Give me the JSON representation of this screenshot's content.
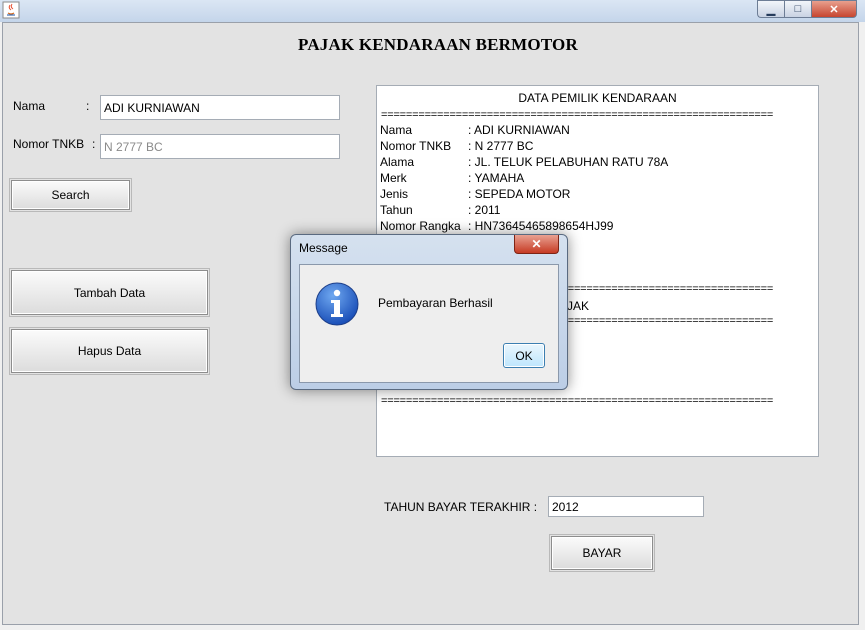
{
  "window": {
    "title_icon": "java-icon",
    "minimize": "▁",
    "maximize": "□",
    "close": "✕"
  },
  "page": {
    "title": "PAJAK KENDARAAN BERMOTOR"
  },
  "form": {
    "nama_label": "Nama",
    "nama_colon": ":",
    "nama_value": "ADI KURNIAWAN",
    "tnkb_label": "Nomor TNKB",
    "tnkb_colon": ":",
    "tnkb_value": "N 2777 BC",
    "search_button": "Search",
    "add_button": "Tambah Data",
    "delete_button": "Hapus Data",
    "tahun_label": "TAHUN BAYAR TERAKHIR :",
    "tahun_value": "2012",
    "bayar_button": "BAYAR"
  },
  "report": {
    "header": "DATA PEMILIK KENDARAAN",
    "separator": "===============================================================",
    "rows": [
      {
        "key": "Nama",
        "value": ": ADI KURNIAWAN"
      },
      {
        "key": "Nomor TNKB",
        "value": ": N 2777 BC"
      },
      {
        "key": "Alama",
        "value": ": JL. TELUK PELABUHAN RATU 78A"
      },
      {
        "key": "Merk",
        "value": ": YAMAHA"
      },
      {
        "key": "Jenis",
        "value": ": SEPEDA MOTOR"
      },
      {
        "key": "Tahun",
        "value": ": 2011"
      },
      {
        "key": "Nomor Rangka",
        "value": ": HN73645465898654HJ99"
      }
    ],
    "partial_text": "JAK"
  },
  "dialog": {
    "title": "Message",
    "close": "✕",
    "icon": "info-icon",
    "message": "Pembayaran Berhasil",
    "ok_button": "OK"
  }
}
